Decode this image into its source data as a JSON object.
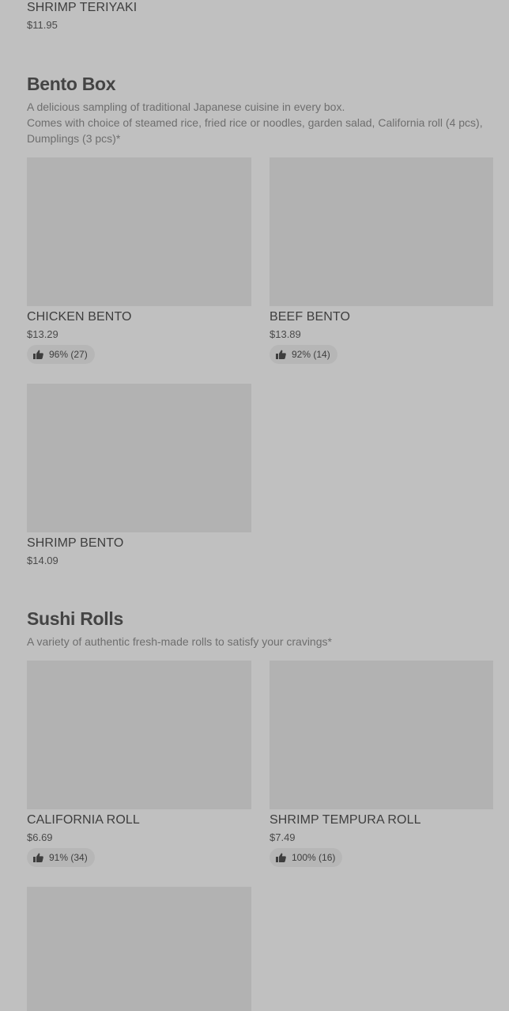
{
  "previous_item": {
    "name": "SHRIMP TERIYAKI",
    "price": "$11.95"
  },
  "sections": [
    {
      "title": "Bento Box",
      "description_lines": [
        "A delicious sampling of traditional Japanese cuisine in every box.",
        "Comes with choice of steamed rice, fried rice or noodles, garden salad, California roll (4 pcs), Dumplings (3 pcs)*"
      ],
      "items": [
        {
          "name": "CHICKEN BENTO",
          "price": "$13.29",
          "rating": "96% (27)"
        },
        {
          "name": "BEEF BENTO",
          "price": "$13.89",
          "rating": "92% (14)"
        },
        {
          "name": "SHRIMP BENTO",
          "price": "$14.09",
          "rating": ""
        }
      ]
    },
    {
      "title": "Sushi Rolls",
      "description_lines": [
        "A variety of authentic fresh-made rolls to satisfy your cravings*"
      ],
      "items": [
        {
          "name": "CALIFORNIA ROLL",
          "price": "$6.69",
          "rating": "91% (34)"
        },
        {
          "name": "SHRIMP TEMPURA ROLL",
          "price": "$7.49",
          "rating": "100% (16)"
        }
      ]
    }
  ],
  "icons": {
    "rating": "thumbs-up-icon"
  },
  "colors": {
    "background": "#c0c0c0",
    "thumbnail": "#b2b2b2",
    "rating_pill": "#b6b6b6"
  }
}
